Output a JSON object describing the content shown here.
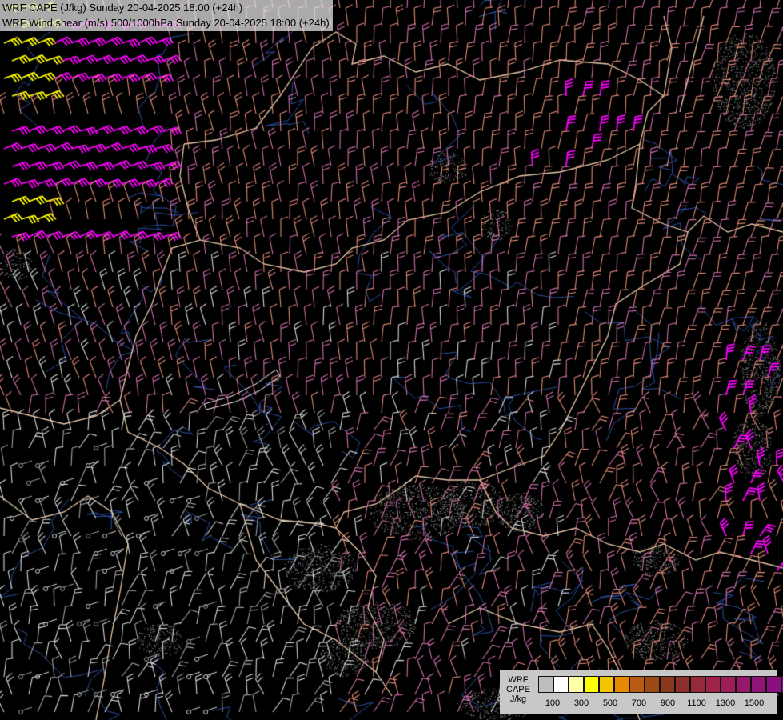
{
  "header": {
    "line1": "WRF CAPE (J/kg) Sunday 20-04-2025 18:00 (+24h)",
    "line2": "WRF Wind shear (m/s) 500/1000hPa Sunday 20-04-2025 18:00 (+24h)"
  },
  "legend": {
    "label_lines": [
      "WRF",
      "CAPE",
      "J/kg"
    ],
    "colors": [
      "#bdbdbd",
      "#ffffff",
      "#ffffa8",
      "#ffff00",
      "#f5c400",
      "#e88a00",
      "#b85a12",
      "#9c4a14",
      "#8a3a1c",
      "#8c2f2c",
      "#962a3a",
      "#a0244a",
      "#9c1e58",
      "#961868",
      "#901474",
      "#8a1080",
      "#86108a"
    ],
    "tick_labels": [
      "100",
      "300",
      "500",
      "700",
      "900",
      "1100",
      "1300",
      "1500"
    ]
  },
  "colors": {
    "background": "#000000",
    "border_line": "#e8c9a8",
    "river_line": "#2b4fa0",
    "barb_light": "#d8d8d8",
    "barb_gray": "#a0a0a0",
    "barb_salmon": "#e48a78",
    "barb_pink": "#d070a8",
    "barb_magenta": "#ff00ff",
    "barb_yellow": "#ffff00"
  }
}
